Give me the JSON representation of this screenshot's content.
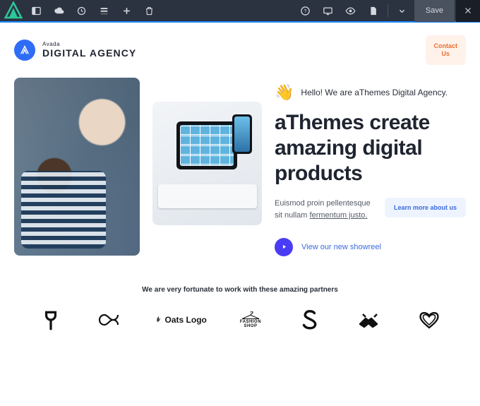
{
  "toolbar": {
    "save_label": "Save"
  },
  "header": {
    "brand_small": "Avada",
    "brand_large": "DIGITAL AGENCY",
    "contact_line1": "Contact",
    "contact_line2": "Us"
  },
  "hero": {
    "wave_emoji": "👋",
    "greeting": "Hello! We are aThemes Digital Agency.",
    "headline": "aThemes create amazing digital products",
    "subtext_plain": "Euismod proin pellentesque sit nullam ",
    "subtext_underlined": "fermentum justo.",
    "learn_more": "Learn more about us",
    "showreel": "View our new showreel"
  },
  "partners": {
    "title": "We are very fortunate to work with these amazing partners",
    "oats_label": "Oats Logo",
    "fashion_l1": "FASHION",
    "fashion_l2": "SHOP"
  }
}
